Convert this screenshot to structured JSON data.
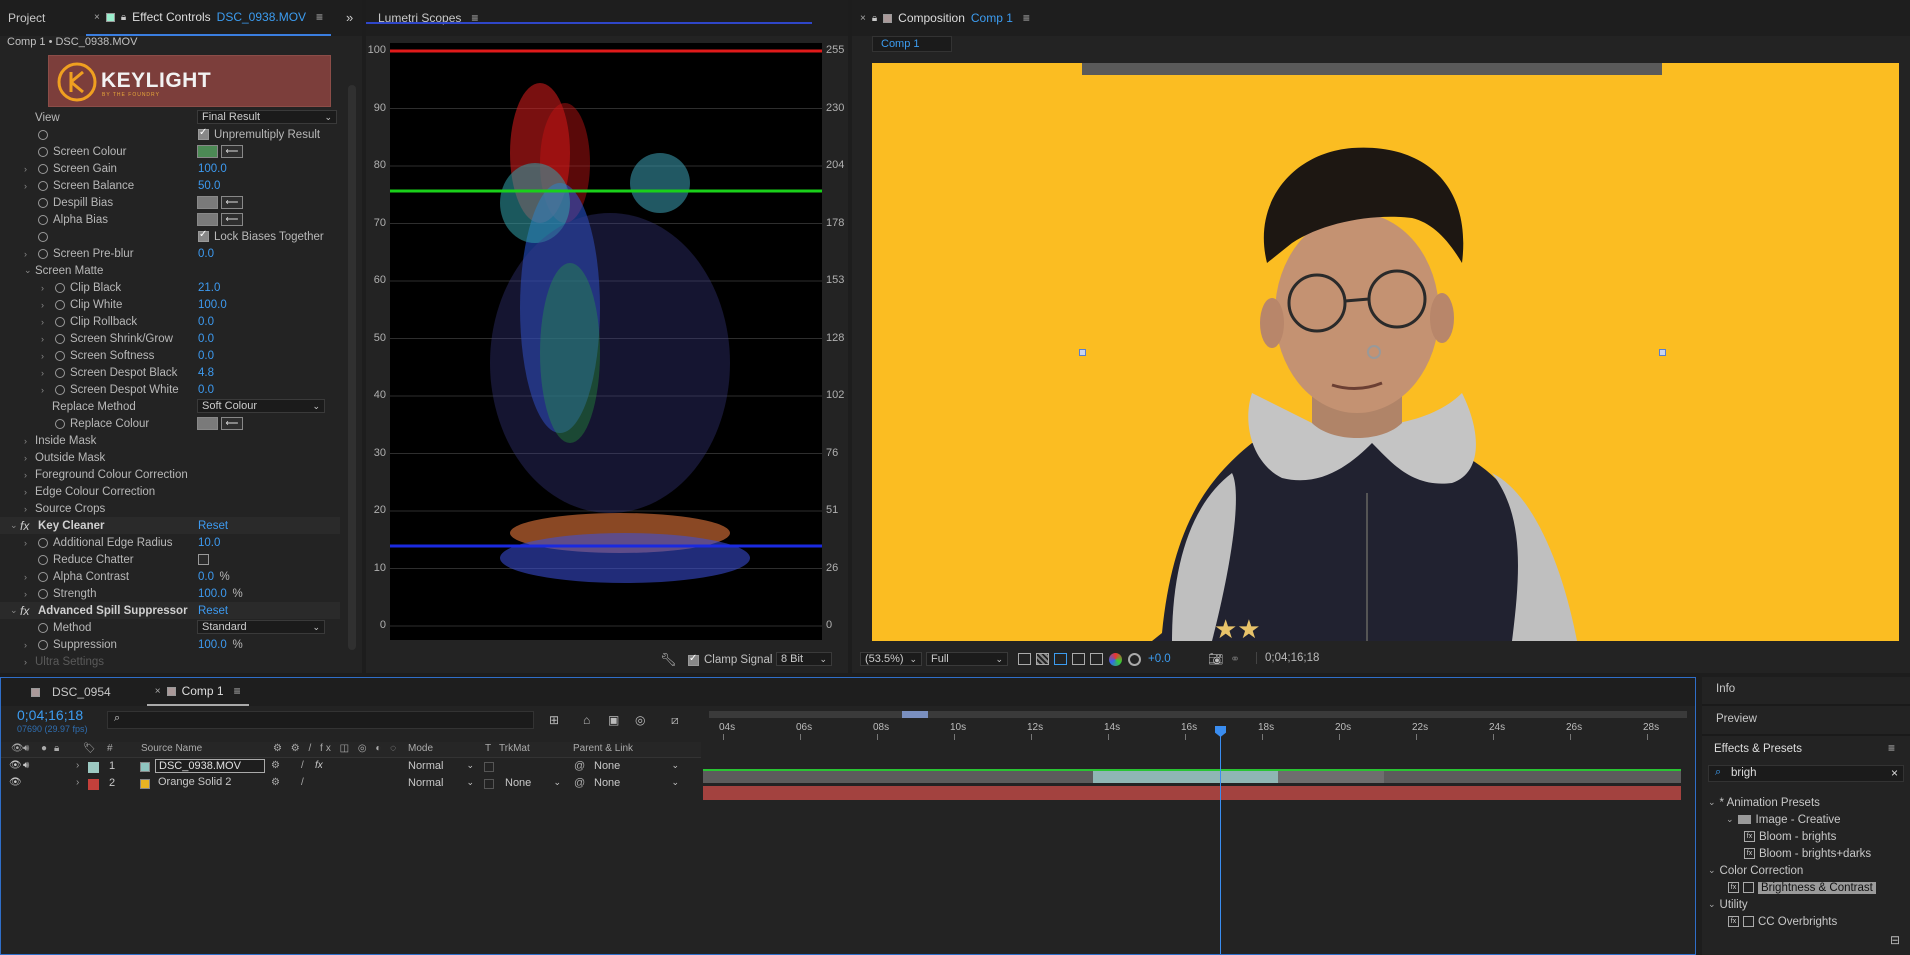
{
  "project_panel": {
    "tab": "Project"
  },
  "effect_controls": {
    "tab_label": "Effect Controls",
    "tab_file": "DSC_0938.MOV",
    "breadcrumb": "Comp 1 • DSC_0938.MOV",
    "logo_text": "KEYLIGHT",
    "logo_sub": "BY THE FOUNDRY",
    "rows": [
      {
        "label": "View",
        "value": "Final Result",
        "kind": "dropdown"
      },
      {
        "label": "",
        "value": "Unpremultiply Result",
        "kind": "checkbox",
        "checked": true
      },
      {
        "label": "Screen Colour",
        "kind": "color",
        "color": "#4c8a55"
      },
      {
        "label": "Screen Gain",
        "value": "100.0",
        "kind": "num"
      },
      {
        "label": "Screen Balance",
        "value": "50.0",
        "kind": "num"
      },
      {
        "label": "Despill Bias",
        "kind": "color",
        "color": "#7a7a7a"
      },
      {
        "label": "Alpha Bias",
        "kind": "color",
        "color": "#7a7a7a"
      },
      {
        "label": "",
        "value": "Lock Biases Together",
        "kind": "checkbox",
        "checked": true
      },
      {
        "label": "Screen Pre-blur",
        "value": "0.0",
        "kind": "num"
      },
      {
        "label": "Screen Matte",
        "kind": "group"
      },
      {
        "label": "Clip Black",
        "value": "21.0",
        "kind": "num"
      },
      {
        "label": "Clip White",
        "value": "100.0",
        "kind": "num"
      },
      {
        "label": "Clip Rollback",
        "value": "0.0",
        "kind": "num"
      },
      {
        "label": "Screen Shrink/Grow",
        "value": "0.0",
        "kind": "num"
      },
      {
        "label": "Screen Softness",
        "value": "0.0",
        "kind": "num"
      },
      {
        "label": "Screen Despot Black",
        "value": "4.8",
        "kind": "num"
      },
      {
        "label": "Screen Despot White",
        "value": "0.0",
        "kind": "num"
      },
      {
        "label": "Replace Method",
        "value": "Soft Colour",
        "kind": "dropdown"
      },
      {
        "label": "Replace Colour",
        "kind": "color",
        "color": "#7a7a7a"
      },
      {
        "label": "Inside Mask",
        "kind": "group"
      },
      {
        "label": "Outside Mask",
        "kind": "group"
      },
      {
        "label": "Foreground Colour Correction",
        "kind": "group"
      },
      {
        "label": "Edge Colour Correction",
        "kind": "group"
      },
      {
        "label": "Source Crops",
        "kind": "group"
      },
      {
        "label": "Key Cleaner",
        "value": "Reset",
        "kind": "fx"
      },
      {
        "label": "Additional Edge Radius",
        "value": "10.0",
        "kind": "num"
      },
      {
        "label": "Reduce Chatter",
        "kind": "checkbox-only",
        "checked": false
      },
      {
        "label": "Alpha Contrast",
        "value": "0.0",
        "unit": "%",
        "kind": "num"
      },
      {
        "label": "Strength",
        "value": "100.0",
        "unit": "%",
        "kind": "num"
      },
      {
        "label": "Advanced Spill Suppressor",
        "value": "Reset",
        "kind": "fx"
      },
      {
        "label": "Method",
        "value": "Standard",
        "kind": "dropdown"
      },
      {
        "label": "Suppression",
        "value": "100.0",
        "unit": "%",
        "kind": "num"
      },
      {
        "label": "Ultra Settings",
        "kind": "group-dim"
      }
    ]
  },
  "lumetri": {
    "tab": "Lumetri Scopes",
    "left_ticks": [
      "100",
      "90",
      "80",
      "70",
      "60",
      "50",
      "40",
      "30",
      "20",
      "10",
      "0"
    ],
    "right_ticks": [
      "255",
      "230",
      "204",
      "178",
      "153",
      "128",
      "102",
      "76",
      "51",
      "26",
      "0"
    ],
    "clamp_label": "Clamp Signal",
    "bit_depth": "8 Bit"
  },
  "composition": {
    "tab_label": "Composition",
    "tab_comp": "Comp 1",
    "sub_tab": "Comp 1",
    "bg_color": "#fbbd22",
    "zoom": "(53.5%)",
    "resolution": "Full",
    "exposure": "+0.0",
    "timecode": "0;04;16;18"
  },
  "timeline": {
    "tabs": [
      "DSC_0954",
      "Comp 1"
    ],
    "timecode": "0;04;16;18",
    "frame_info": "07690 (29.97 fps)",
    "search_placeholder": "",
    "columns": {
      "num": "#",
      "source": "Source Name",
      "mode": "Mode",
      "t": "T",
      "trkmat": "TrkMat",
      "parent": "Parent & Link"
    },
    "ruler": [
      "04s",
      "06s",
      "08s",
      "10s",
      "12s",
      "14s",
      "16s",
      "18s",
      "20s",
      "22s",
      "24s",
      "26s",
      "28s"
    ],
    "layers": [
      {
        "num": "1",
        "name": "DSC_0938.MOV",
        "color": "#8fc5c0",
        "mode": "Normal",
        "trkmat": "",
        "parent": "None"
      },
      {
        "num": "2",
        "name": "Orange Solid 2",
        "color": "#e8b322",
        "mode": "Normal",
        "trkmat": "None",
        "parent": "None"
      }
    ]
  },
  "right_panel": {
    "info": "Info",
    "preview": "Preview",
    "effects_title": "Effects & Presets",
    "search_value": "brigh",
    "tree": [
      {
        "label": "* Animation Presets",
        "level": 0,
        "type": "folder-open"
      },
      {
        "label": "Image - Creative",
        "level": 1,
        "type": "folder"
      },
      {
        "label": "Bloom - brights",
        "level": 2,
        "type": "preset"
      },
      {
        "label": "Bloom - brights+darks",
        "level": 2,
        "type": "preset"
      },
      {
        "label": "Color Correction",
        "level": 0,
        "type": "folder-open"
      },
      {
        "label": "Brightness & Contrast",
        "level": 1,
        "type": "effect",
        "selected": true
      },
      {
        "label": "Utility",
        "level": 0,
        "type": "folder-open"
      },
      {
        "label": "CC Overbrights",
        "level": 1,
        "type": "effect"
      }
    ]
  }
}
